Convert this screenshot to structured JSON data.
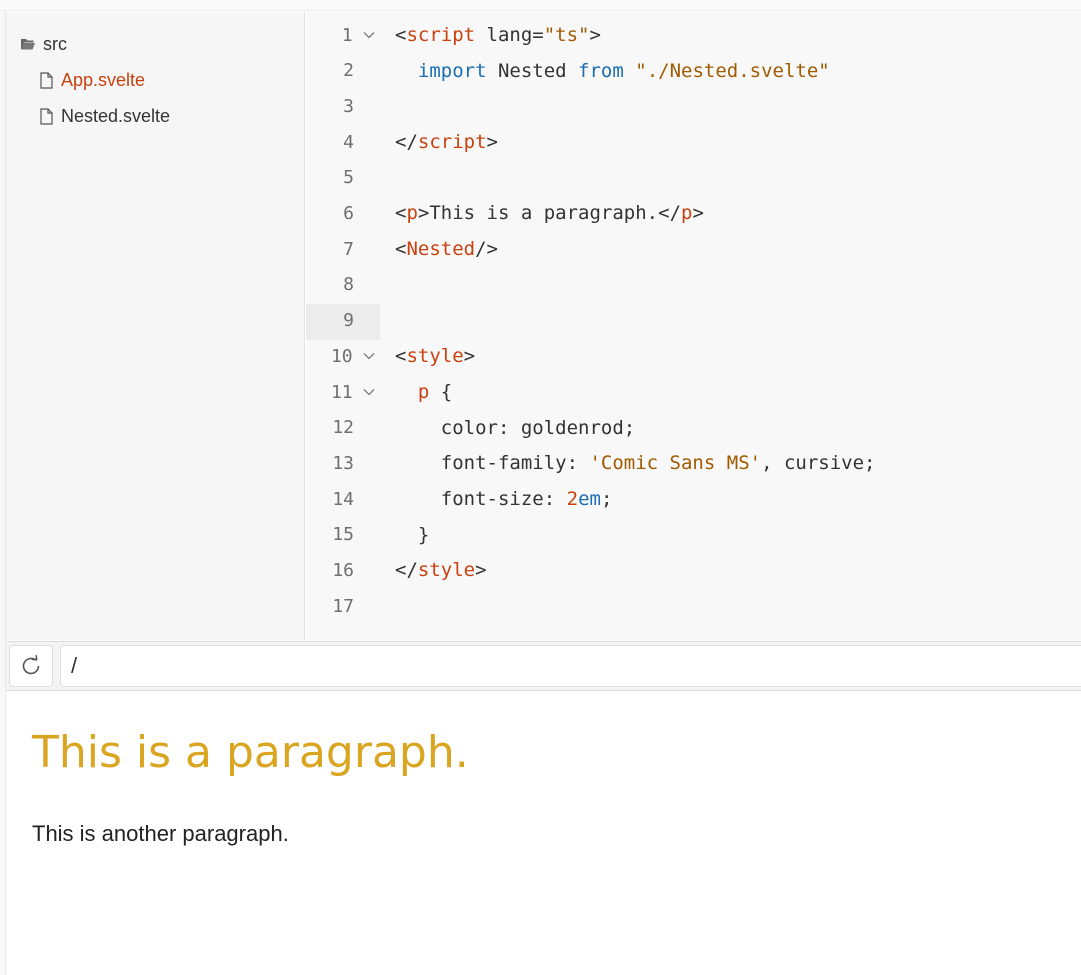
{
  "file_tree": {
    "folder": {
      "label": "src",
      "icon": "folder-open-icon"
    },
    "files": [
      {
        "label": "App.svelte",
        "icon": "file-icon",
        "selected": true
      },
      {
        "label": "Nested.svelte",
        "icon": "file-icon",
        "selected": false
      }
    ]
  },
  "editor": {
    "line_numbers": [
      "1",
      "2",
      "3",
      "4",
      "5",
      "6",
      "7",
      "8",
      "9",
      "10",
      "11",
      "12",
      "13",
      "14",
      "15",
      "16",
      "17"
    ],
    "active_line": "9",
    "folded_lines": [
      "1",
      "10",
      "11"
    ],
    "lines": {
      "l1": {
        "open": "<",
        "tag": "script",
        "attr": " lang=",
        "value": "\"ts\"",
        "close": ">"
      },
      "l2": {
        "indent": "  ",
        "kw_import": "import",
        "name": " Nested ",
        "kw_from": "from",
        "space": " ",
        "path": "\"./Nested.svelte\""
      },
      "l4": {
        "open": "</",
        "tag": "script",
        "close": ">"
      },
      "l6": {
        "open": "<",
        "tag": "p",
        "mid": ">This is a paragraph.</",
        "tag2": "p",
        "close": ">"
      },
      "l7": {
        "open": "<",
        "tag": "Nested",
        "close": "/>"
      },
      "l10": {
        "open": "<",
        "tag": "style",
        "close": ">"
      },
      "l11": {
        "indent": "  ",
        "selector": "p",
        "brace": " {"
      },
      "l12": {
        "indent": "    ",
        "text": "color: goldenrod;"
      },
      "l13": {
        "indent": "    ",
        "prop": "font-family: ",
        "str": "'Comic Sans MS'",
        "rest": ", cursive;"
      },
      "l14": {
        "indent": "    ",
        "prop": "font-size: ",
        "num": "2",
        "unit": "em",
        "semi": ";"
      },
      "l15": {
        "indent": "  ",
        "brace": "}"
      },
      "l16": {
        "open": "</",
        "tag": "style",
        "close": ">"
      }
    }
  },
  "preview_bar": {
    "reload_icon": "reload-icon",
    "url": "/"
  },
  "preview": {
    "styled_paragraph": "This is a paragraph.",
    "nested_paragraph": "This is another paragraph."
  },
  "colors": {
    "tag": "#c9410f",
    "keyword": "#1a6fb3",
    "string": "#a05a00",
    "selected_file": "#c9410f",
    "goldenrod": "#daa520"
  }
}
